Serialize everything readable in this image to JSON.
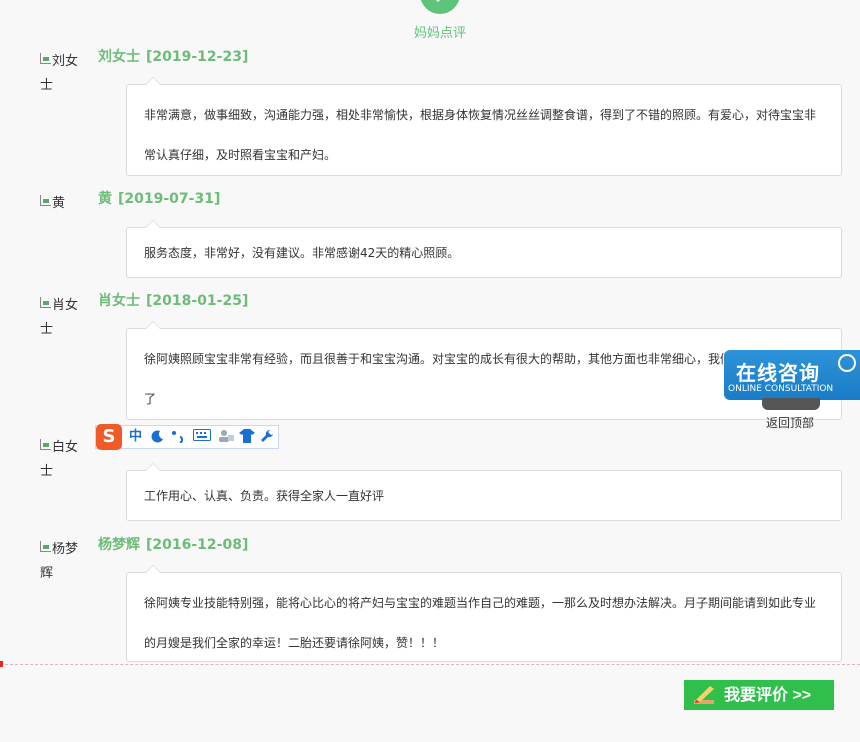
{
  "section": {
    "title": "妈妈点评"
  },
  "reviews": [
    {
      "avatar_alt": "刘女士",
      "name": "刘女士",
      "date": "[2019-12-23]",
      "text": "非常满意，做事细致，沟通能力强，相处非常愉快，根据身体恢复情况丝丝调整食谱，得到了不错的照顾。有爱心，对待宝宝非常认真仔细，及时照看宝宝和产妇。"
    },
    {
      "avatar_alt": "黄",
      "name": "黄",
      "date": "[2019-07-31]",
      "text": "服务态度，非常好，没有建议。非常感谢42天的精心照顾。"
    },
    {
      "avatar_alt": "肖女士",
      "name": "肖女士",
      "date": "[2018-01-25]",
      "text": "徐阿姨照顾宝宝非常有经验，而且很善于和宝宝沟通。对宝宝的成长有很大的帮助，其他方面也非常细心，我们的"
    },
    {
      "avatar_alt": "白女士",
      "name": "",
      "date": "",
      "text": "工作用心、认真、负责。获得全家人一直好评"
    },
    {
      "avatar_alt": "杨梦辉",
      "name": "杨梦辉",
      "date": "[2016-12-08]",
      "text": "徐阿姨专业技能特别强，能将心比心的将产妇与宝宝的难题当作自己的难题，一那么及时想办法解决。月子期间能请到如此专业的月嫂是我们全家的幸运！二胎还要请徐阿姨，赞！！！"
    }
  ],
  "review_3_tail": "了",
  "ime_toolbar": {
    "logo": "S",
    "mode": "中",
    "items": [
      "moon-icon",
      "punctuation-icon",
      "keyboard-icon",
      "user-icon",
      "skin-icon",
      "wrench-icon"
    ]
  },
  "consult": {
    "title": "在线咨询",
    "subtitle": "ONLINE CONSULTATION"
  },
  "back_to_top": "返回顶部",
  "review_button": "我要评价 >>",
  "colors": {
    "accent": "#6cbd78",
    "consult_blue": "#1a7cc7",
    "button_green": "#2fbf4a"
  }
}
